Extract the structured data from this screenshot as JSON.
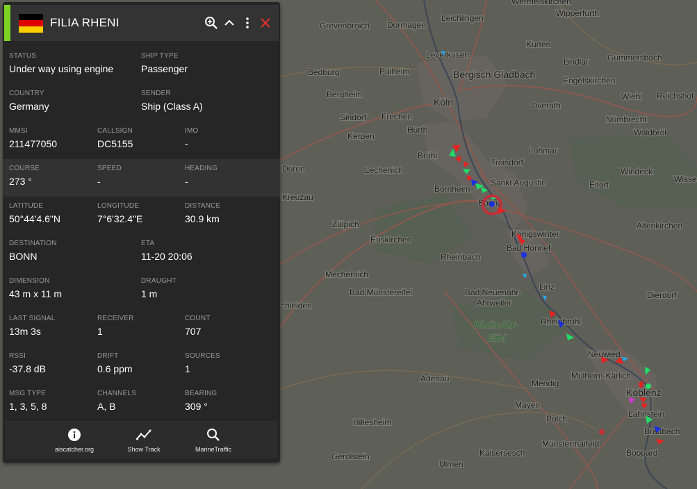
{
  "vessel": {
    "name": "FILIA RHENI",
    "flag_colors": [
      "#000000",
      "#dd0000",
      "#ffce00"
    ],
    "accent_color": "#7dd321"
  },
  "header_icons": [
    "zoom-in-icon",
    "chevron-up-icon",
    "more-vert-icon",
    "close-icon"
  ],
  "fields": {
    "status": {
      "label": "STATUS",
      "value": "Under way using engine"
    },
    "ship_type": {
      "label": "SHIP TYPE",
      "value": "Passenger"
    },
    "country": {
      "label": "COUNTRY",
      "value": "Germany"
    },
    "sender": {
      "label": "SENDER",
      "value": "Ship (Class A)"
    },
    "mmsi": {
      "label": "MMSI",
      "value": "211477050"
    },
    "callsign": {
      "label": "CALLSIGN",
      "value": "DC5155"
    },
    "imo": {
      "label": "IMO",
      "value": "-"
    },
    "course": {
      "label": "COURSE",
      "value": "273 °"
    },
    "speed": {
      "label": "SPEED",
      "value": "-"
    },
    "heading": {
      "label": "HEADING",
      "value": "-"
    },
    "latitude": {
      "label": "LATITUDE",
      "value": "50°44'4.6\"N"
    },
    "longitude": {
      "label": "LONGITUDE",
      "value": "7°6'32.4\"E"
    },
    "distance": {
      "label": "DISTANCE",
      "value": "30.9 km"
    },
    "destination": {
      "label": "DESTINATION",
      "value": "BONN"
    },
    "eta": {
      "label": "ETA",
      "value": "11-20 20:06"
    },
    "dimension": {
      "label": "DIMENSION",
      "value": "43 m x 11 m"
    },
    "draught": {
      "label": "DRAUGHT",
      "value": "1 m"
    },
    "last_signal": {
      "label": "LAST SIGNAL",
      "value": "13m 3s"
    },
    "receiver": {
      "label": "RECEIVER",
      "value": "1"
    },
    "count": {
      "label": "COUNT",
      "value": "707"
    },
    "rssi": {
      "label": "RSSI",
      "value": "-37.8 dB"
    },
    "drift": {
      "label": "DRIFT",
      "value": "0.6 ppm"
    },
    "sources": {
      "label": "SOURCES",
      "value": "1"
    },
    "msg_type": {
      "label": "MSG TYPE",
      "value": "1, 3, 5, 8"
    },
    "channels": {
      "label": "CHANNELS",
      "value": "A, B"
    },
    "bearing": {
      "label": "BEARING",
      "value": "309 °"
    }
  },
  "footer": {
    "site": {
      "label": "aiscatcher.org",
      "icon": "info-icon"
    },
    "track": {
      "label": "Show Track",
      "icon": "track-icon"
    },
    "marinetraffic": {
      "label": "MarineTraffic",
      "icon": "search-icon"
    }
  },
  "map": {
    "places": {
      "leichlingen": "Leichlingen",
      "wermelskirchen": "Wermelskirchen",
      "wipperfurth": "Wipperfurth",
      "dormagen": "Dormagen",
      "grevenbroich": "Grevenbroich",
      "kurten": "Kurten",
      "leverkusen": "Leverkusen",
      "gummersbach": "Gummersbach",
      "bedburg": "Bedburg",
      "pulheim": "Pulheim",
      "bergisch_gladbach": "Bergisch Gladbach",
      "lindlar": "Lindlar",
      "engelskirchen": "Engelskirchen",
      "bergheim": "Bergheim",
      "koln": "Köln",
      "reichshof": "Reichshof",
      "wiehl": "Wiehl",
      "sindorf": "Sindorf",
      "frechen": "Frechen",
      "overath": "Overath",
      "kerpen": "Kerpen",
      "hurth": "Hürth",
      "numbrecht": "Nümbrecht",
      "waldbrol": "Waldbröl",
      "bruhl": "Brühl",
      "troisdorf": "Troisdorf",
      "lohmar": "Lohmar",
      "duren": "Düren",
      "lechenich": "Lechenich",
      "windeck": "Windeck",
      "sankt_augustin": "Sankt Augustin",
      "bornheim": "Bornheim",
      "wissen": "Wisse",
      "kreuzau": "Kreuzau",
      "eitorf": "Eitorf",
      "bonn": "Bonn",
      "zulpich": "Zülpich",
      "altenkirchen": "Altenkirchen",
      "konigswinter": "Königswinter",
      "euskirchen": "Euskirchen",
      "bad_honnef": "Bad Honnef",
      "rheinbach": "Rheinbach",
      "mechernich": "Mechernich",
      "linz": "Linz",
      "bad_munstereifel": "Bad Münstereifel",
      "bad_neuenahr": "Bad Neuenahr-",
      "ahrweiler": "Ahrweiler",
      "dierdorf": "Dierdorf",
      "schleiden": "chleiden",
      "rhein_ahr": "Rhein-Ahr-",
      "eifel": "Eifel",
      "rheinbrohl": "Rheinbrohl",
      "neuwied": "Neuwied",
      "mulheim_karlich": "Mülheim-Kärlich",
      "adenau": "Adenau",
      "mendig": "Mendig",
      "koblenz": "Koblenz",
      "mayen": "Mayen",
      "lahnstein": "Lahnstein",
      "polch": "Polch",
      "hillesheim": "Hillesheim",
      "braubach": "Braubach",
      "munstermaifeld": "Münstermaifeld",
      "kaisersesch": "Kaisersesch",
      "gerolstein": "Gerolstein",
      "boppard": "Boppard",
      "ulmen": "Ulmen"
    }
  }
}
